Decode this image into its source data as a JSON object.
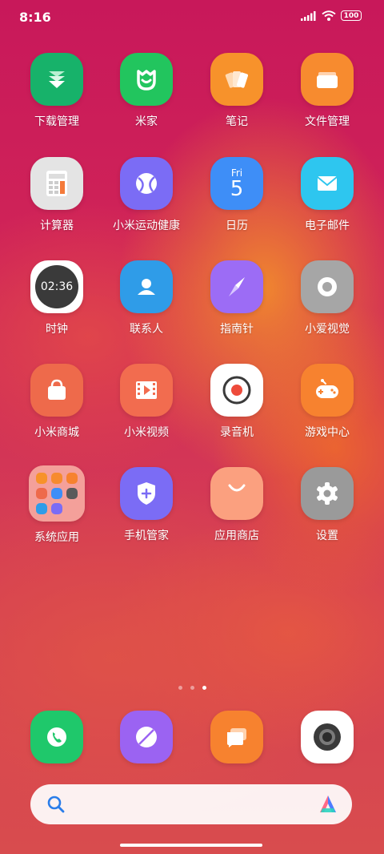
{
  "status_bar": {
    "time": "8:16",
    "battery": "100"
  },
  "apps": [
    {
      "label": "下载管理",
      "icon": "download-icon",
      "color": "#17b26a"
    },
    {
      "label": "米家",
      "icon": "mijia-icon",
      "color": "#22c55e"
    },
    {
      "label": "笔记",
      "icon": "notes-icon",
      "color": "#f7922b"
    },
    {
      "label": "文件管理",
      "icon": "folder-icon",
      "color": "#f78b2f"
    },
    {
      "label": "计算器",
      "icon": "calculator-icon",
      "color": "#e4e4e4"
    },
    {
      "label": "小米运动健康",
      "icon": "fitness-icon",
      "color": "#7b6cf5"
    },
    {
      "label": "日历",
      "icon": "calendar-icon",
      "color": "#3e8ef7",
      "day_name": "Fri",
      "day_num": "5"
    },
    {
      "label": "电子邮件",
      "icon": "mail-icon",
      "color": "#2ec6ef"
    },
    {
      "label": "时钟",
      "icon": "clock-icon",
      "color": "#ffffff",
      "clock_text": "02:36"
    },
    {
      "label": "联系人",
      "icon": "contacts-icon",
      "color": "#2f9ce8"
    },
    {
      "label": "指南针",
      "icon": "compass-icon",
      "color": "#9c6cf5"
    },
    {
      "label": "小爱视觉",
      "icon": "xiaoai-vision-icon",
      "color": "#a6a6a6"
    },
    {
      "label": "小米商城",
      "icon": "shop-icon",
      "color": "#ee6a4b"
    },
    {
      "label": "小米视频",
      "icon": "video-icon",
      "color": "#f26c4f"
    },
    {
      "label": "录音机",
      "icon": "recorder-icon",
      "color": "#ffffff"
    },
    {
      "label": "游戏中心",
      "icon": "game-icon",
      "color": "#f7822f"
    },
    {
      "label": "系统应用",
      "icon": "folder-system-apps-icon",
      "color": "#f4a09a"
    },
    {
      "label": "手机管家",
      "icon": "security-icon",
      "color": "#7b6cf5"
    },
    {
      "label": "应用商店",
      "icon": "app-store-icon",
      "color": "#fba07f"
    },
    {
      "label": "设置",
      "icon": "settings-icon",
      "color": "#9a9a9a"
    }
  ],
  "dock": [
    {
      "icon": "phone-icon",
      "color": "#1fc86b"
    },
    {
      "icon": "browser-icon",
      "color": "#9b63f2"
    },
    {
      "icon": "messages-icon",
      "color": "#f7822f"
    },
    {
      "icon": "camera-icon",
      "color": "#ffffff"
    }
  ],
  "search": {
    "icon": "search-icon",
    "assistant_icon": "xiaoai-assistant-icon"
  }
}
